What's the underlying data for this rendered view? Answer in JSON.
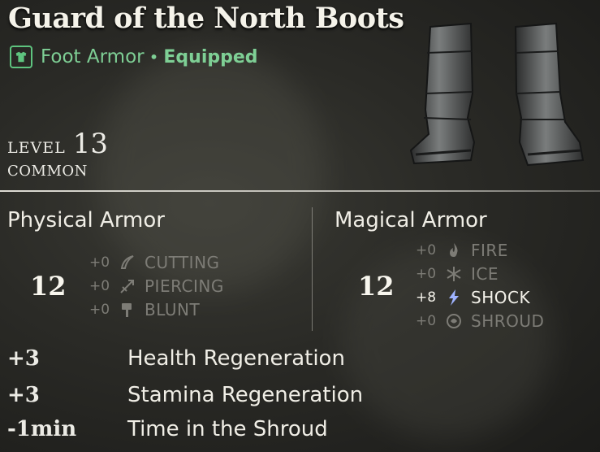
{
  "item": {
    "name": "Guard of the North Boots",
    "category": "Foot Armor",
    "separator": "•",
    "status": "Equipped",
    "level_label": "LEVEL",
    "level_value": "13",
    "rarity": "COMMON"
  },
  "colors": {
    "accent_green": "#7ecf95",
    "inactive_gray": "#7d7c76",
    "text": "#ecebe5"
  },
  "physical": {
    "title": "Physical Armor",
    "total": "12",
    "rows": [
      {
        "value": "+0",
        "name": "CUTTING",
        "icon": "cutting-icon",
        "active": false
      },
      {
        "value": "+0",
        "name": "PIERCING",
        "icon": "piercing-icon",
        "active": false
      },
      {
        "value": "+0",
        "name": "BLUNT",
        "icon": "blunt-icon",
        "active": false
      }
    ]
  },
  "magical": {
    "title": "Magical Armor",
    "total": "12",
    "rows": [
      {
        "value": "+0",
        "name": "FIRE",
        "icon": "fire-icon",
        "active": false
      },
      {
        "value": "+0",
        "name": "ICE",
        "icon": "snowflake-icon",
        "active": false
      },
      {
        "value": "+8",
        "name": "SHOCK",
        "icon": "lightning-icon",
        "active": true
      },
      {
        "value": "+0",
        "name": "SHROUD",
        "icon": "shroud-icon",
        "active": false
      }
    ]
  },
  "bonuses": [
    {
      "value": "+3",
      "label": "Health Regeneration"
    },
    {
      "value": "+3",
      "label": "Stamina Regeneration"
    },
    {
      "value": "-1min",
      "label": "Time in the Shroud"
    }
  ]
}
